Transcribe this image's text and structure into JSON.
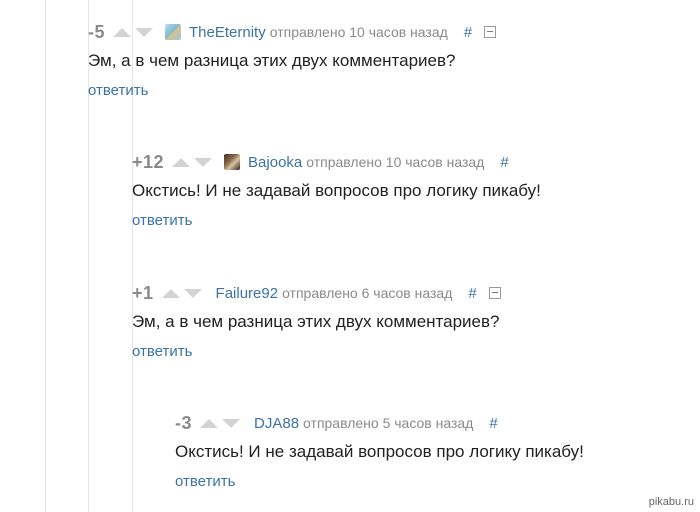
{
  "comments": [
    {
      "rating": "-5",
      "username": "TheEternity",
      "meta": "отправлено 10 часов назад",
      "hash": "#",
      "text": "Эм, а в чем разница этих двух комментариев?",
      "reply_label": "ответить",
      "avatar": "landscape-avatar-icon",
      "collapsible": true
    },
    {
      "rating": "+12",
      "username": "Bajooka",
      "meta": "отправлено 10 часов назад",
      "hash": "#",
      "text": "Окстись! И не задавай вопросов про логику пикабу!",
      "reply_label": "ответить",
      "avatar": "portrait-avatar-icon",
      "collapsible": false
    },
    {
      "rating": "+1",
      "username": "Failure92",
      "meta": "отправлено 6 часов назад",
      "hash": "#",
      "text": "Эм, а в чем разница этих двух комментариев?",
      "reply_label": "ответить",
      "avatar": null,
      "collapsible": true
    },
    {
      "rating": "-3",
      "username": "DJA88",
      "meta": "отправлено 5 часов назад",
      "hash": "#",
      "text": "Окстись! И не задавай вопросов про логику пикабу!",
      "reply_label": "ответить",
      "avatar": null,
      "collapsible": false
    }
  ],
  "watermark": "pikabu.ru",
  "colors": {
    "link": "#3b73a4",
    "rating": "#8a8a8a",
    "vote_arrow": "#d3d3d3",
    "rail": "#e6e6e6"
  }
}
